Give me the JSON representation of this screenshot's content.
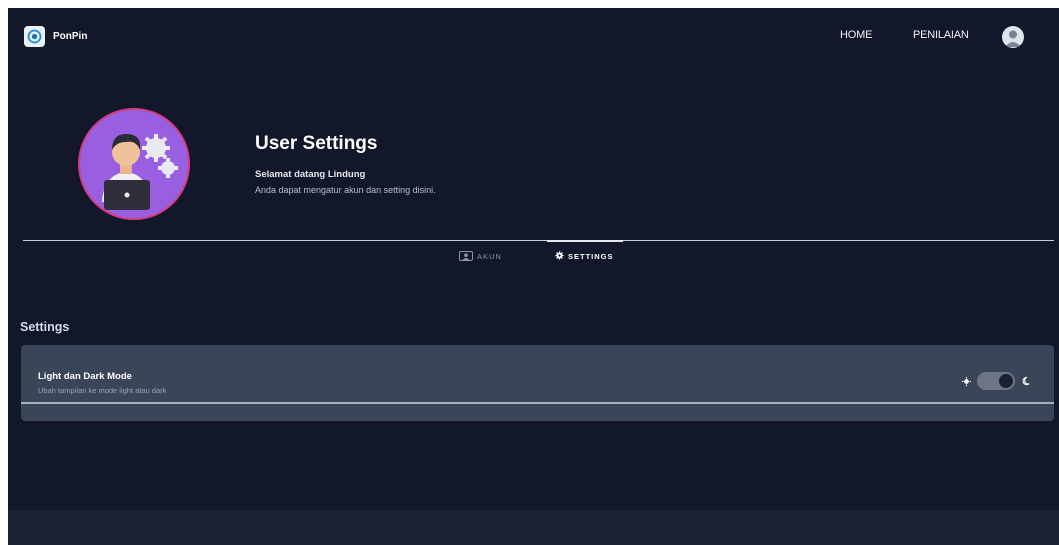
{
  "navbar": {
    "brand": "PonPin",
    "links": [
      "HOME",
      "PENILAIAN"
    ]
  },
  "header": {
    "title": "User Settings",
    "welcome": "Selamat datang Lindung",
    "description": "Anda dapat mengatur akun dan setting disini."
  },
  "tabs": {
    "akun": "AKUN",
    "settings": "SETTINGS"
  },
  "settings": {
    "section_title": "Settings",
    "theme": {
      "title": "Light dan Dark Mode",
      "subtitle": "Ubah tampilan ke mode light atau dark",
      "dark_mode_enabled": true
    }
  },
  "icons": {
    "brand": "brand-logo-icon",
    "profile": "user-avatar-icon",
    "akun": "account-icon",
    "settings": "gear-icon",
    "light": "sun-icon",
    "dark": "moon-icon"
  },
  "colors": {
    "background": "#121829",
    "card": "#3a4558",
    "avatar_bg": "#9a5fe0",
    "avatar_ring": "#d23e86"
  }
}
